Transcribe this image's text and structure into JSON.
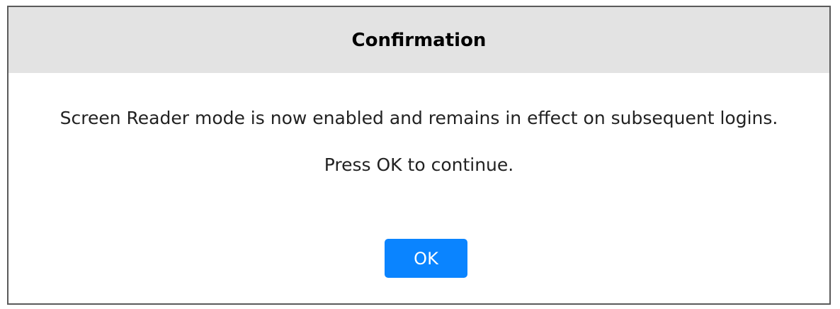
{
  "dialog": {
    "title": "Confirmation",
    "message": "Screen Reader mode is now enabled and remains in effect on subsequent logins.",
    "instruction": "Press OK to continue.",
    "ok_label": "OK"
  },
  "colors": {
    "header_background": "#e3e3e3",
    "button_background": "#0a84ff",
    "border": "#5a5a5a"
  }
}
